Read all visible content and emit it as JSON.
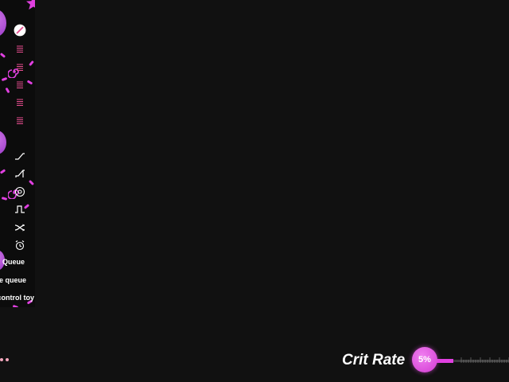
{
  "colors": {
    "background": "#111111",
    "sidebar": "#0c0c0c",
    "accent": "#e040e0",
    "icon": "#e74d8f",
    "text": "#ffffff",
    "track": "#3a3a3a"
  },
  "sidebar": {
    "icons": [
      "cancel-icon",
      "list-icon",
      "list-icon",
      "list-icon",
      "list-icon",
      "list-icon",
      "ramp-up-icon",
      "step-up-icon",
      "spiral-icon",
      "square-wave-icon",
      "shuffle-icon",
      "alarm-clock-icon"
    ],
    "menu": {
      "queue": "Queue",
      "save_queue": "e queue",
      "control_toy": "control toy"
    }
  },
  "crit_rate": {
    "label": "Crit Rate",
    "value_text": "5%",
    "value": 5
  },
  "pagination": {
    "dots": 2
  }
}
